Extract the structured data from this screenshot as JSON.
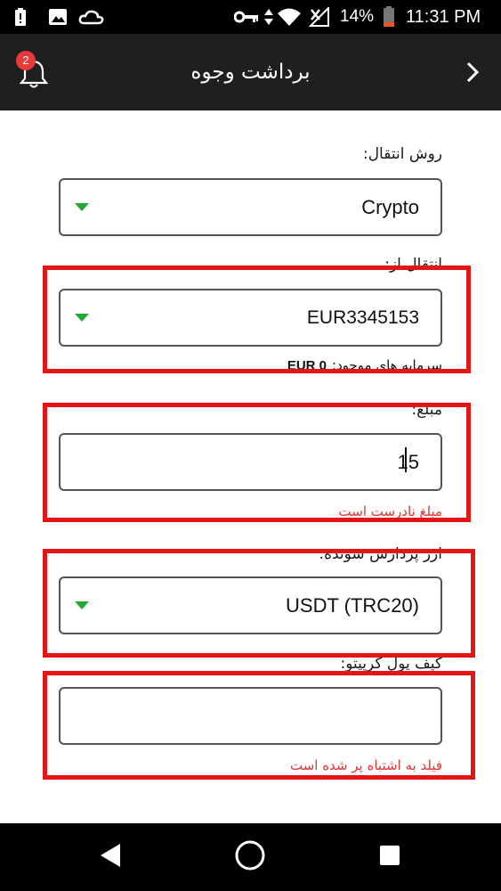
{
  "status_bar": {
    "battery_percent": "14%",
    "time": "11:31 PM",
    "icons": [
      "alert-icon",
      "image-icon",
      "cloud-icon",
      "vpn-key-icon",
      "data-arrows-icon",
      "wifi-icon",
      "signal-icon",
      "battery-icon"
    ]
  },
  "header": {
    "title": "برداشت وجوه",
    "notification_count": "2",
    "back_icon": "chevron-right-icon",
    "bell_icon": "bell-icon"
  },
  "form": {
    "transfer_method": {
      "label": "روش انتقال:",
      "value": "Crypto"
    },
    "transfer_from": {
      "label": "انتقال از:",
      "value": "EUR3345153"
    },
    "balance": {
      "label": "سرمایه های موجود:",
      "value": "EUR 0"
    },
    "amount": {
      "label": "مبلغ:",
      "value": "15",
      "error": "مبلغ نادرست است"
    },
    "processing_currency": {
      "label": "ارز پردازش شونده:",
      "value": "USDT (TRC20)"
    },
    "crypto_wallet": {
      "label": "کیف پول کریپتو:",
      "value": "",
      "error": "فیلد به اشتباه پر شده است"
    }
  },
  "colors": {
    "header_bg": "#1f1f1f",
    "dropdown_caret": "#22a833",
    "error_text": "#e03535",
    "highlight_box": "#e61515",
    "badge": "#e83a3a"
  },
  "nav_bar": {
    "icons": [
      "back-triangle-icon",
      "home-circle-icon",
      "recents-square-icon"
    ]
  }
}
